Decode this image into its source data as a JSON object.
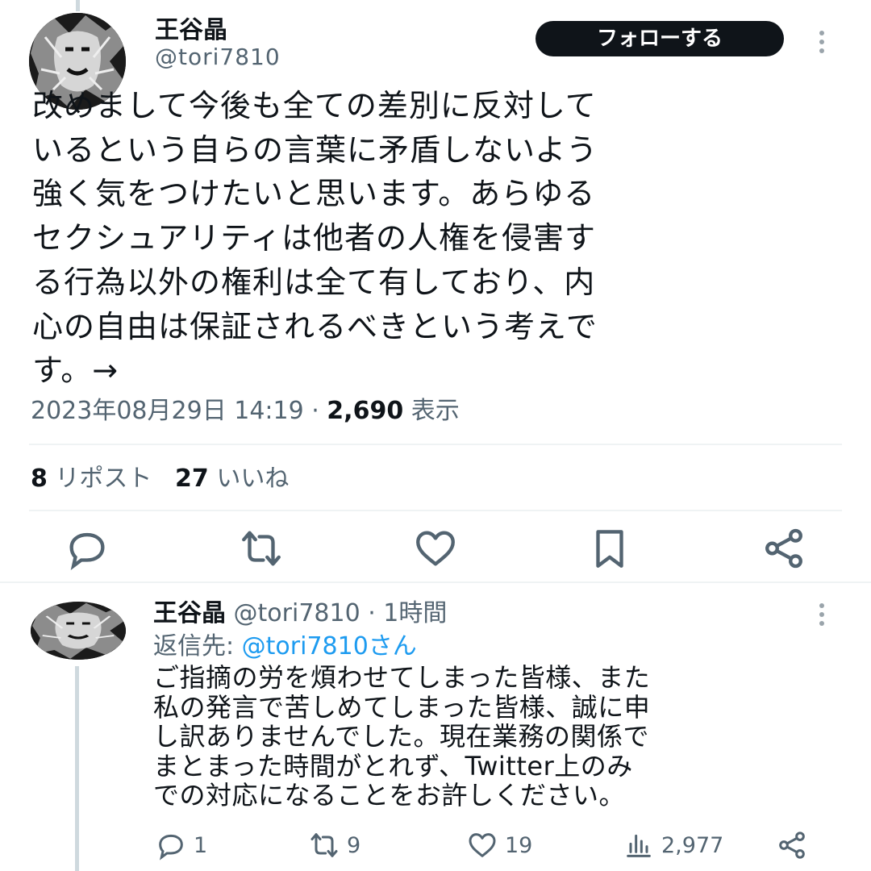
{
  "tweet": {
    "author_name": "王谷晶",
    "author_handle": "@tori7810",
    "follow_label": "フォローする",
    "text_lines": [
      "改めまして今後も全ての差別に反対して",
      "いるという自らの言葉に矛盾しないよう",
      "強く気をつけたいと思います。あらゆる",
      "セクシュアリティは他者の人権を侵害す",
      "る行為以外の権利は全て有しており、内",
      "心の自由は保証されるべきという考えで",
      "す。→"
    ],
    "date": "2023年08月29日 14:19",
    "separator": " · ",
    "views_count": "2,690",
    "views_label": " 表示",
    "reposts_count": "8",
    "reposts_label": " リポスト",
    "likes_count": "27",
    "likes_label": " いいね"
  },
  "actions": {
    "icons": [
      "reply-icon",
      "retweet-icon",
      "like-icon",
      "bookmark-icon",
      "share-icon"
    ]
  },
  "reply": {
    "author_name": "王谷晶",
    "meta": " @tori7810 · 1時間",
    "reply_to_label": "返信先: ",
    "reply_to_handle": "@tori7810さん",
    "text_lines": [
      "ご指摘の労を煩わせてしまった皆様、また",
      "私の発言で苦しめてしまった皆様、誠に申",
      "し訳ありませんでした。現在業務の関係で",
      "まとまった時間がとれず、Twitter上のみ",
      "での対応になることをお許しください。"
    ],
    "reply_count": "1",
    "retweet_count": "9",
    "like_count": "19",
    "views_count": "2,977"
  },
  "colors": {
    "text": "#0f1419",
    "secondary": "#536471",
    "link": "#1d9bf0",
    "divider": "#eff3f4",
    "icon": "#536471"
  }
}
